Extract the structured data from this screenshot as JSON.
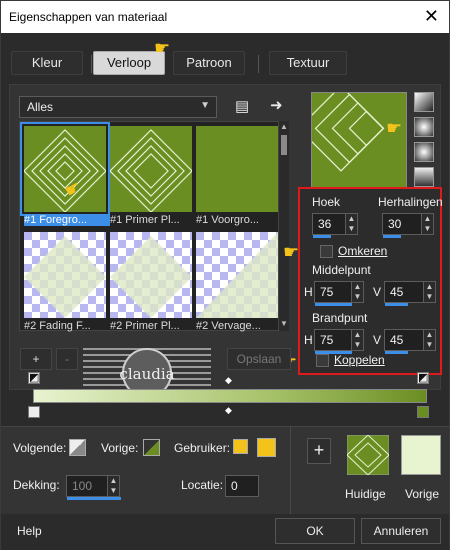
{
  "window": {
    "title": "Eigenschappen van materiaal",
    "close_glyph": "✕"
  },
  "tabs": [
    {
      "label": "Kleur"
    },
    {
      "label": "Verloop"
    },
    {
      "label": "Patroon"
    },
    {
      "label": "Textuur"
    }
  ],
  "gallery": {
    "category": "Alles",
    "items": [
      {
        "label": "#1 Foregro..."
      },
      {
        "label": "#1 Primer Pl..."
      },
      {
        "label": "#1 Voorgro..."
      },
      {
        "label": "#2 Fading F..."
      },
      {
        "label": "#2 Primer Pl..."
      },
      {
        "label": "#2 Vervage..."
      }
    ]
  },
  "settings": {
    "angle_label": "Hoek",
    "angle_value": "36",
    "repeats_label": "Herhalingen",
    "repeats_value": "30",
    "invert_label": "Omkeren",
    "center_label": "Middelpunt",
    "center_h_label": "H",
    "center_h": "75",
    "center_v_label": "V",
    "center_v": "45",
    "focus_label": "Brandpunt",
    "focus_h_label": "H",
    "focus_h": "75",
    "focus_v_label": "V",
    "focus_v": "45",
    "link_label": "Koppelen"
  },
  "editor": {
    "add_label": "+",
    "remove_label": "-",
    "save_label": "Opslaan",
    "watermark_text": "claudia"
  },
  "bottom": {
    "next_label": "Volgende:",
    "prev_label": "Vorige:",
    "user_label": "Gebruiker:",
    "opacity_label": "Dekking:",
    "opacity_value": "100",
    "location_label": "Locatie:",
    "location_value": "0",
    "current_label": "Huidige",
    "previous_label": "Vorige",
    "plus_label": "+"
  },
  "footer": {
    "help": "Help",
    "ok": "OK",
    "cancel": "Annuleren"
  },
  "colors": {
    "accent": "#3d8ee6",
    "green": "#6b8e23",
    "light_green": "#e8f3d0",
    "highlight": "#e01a1a",
    "user_swatch": "#f3c21b"
  }
}
